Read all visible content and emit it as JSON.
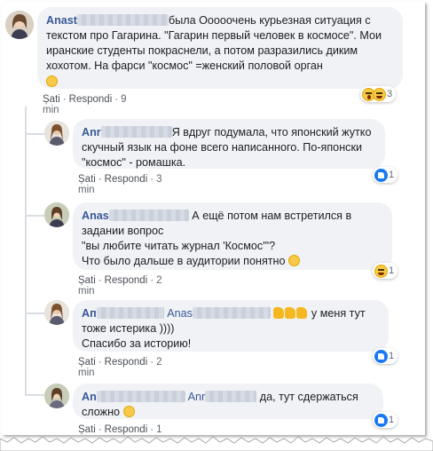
{
  "comments": [
    {
      "author": "Anast",
      "text": "была Ооооочень курьезная ситуация с текстом про Гагарина. \"Гагарин первый человек в космосе\". Мои иранские студенты покраснели, а потом разразились диким хохотом. На фарси \"космос\" =женский половой орган",
      "like": "Șati",
      "reply": "Respondi",
      "time": "9 min",
      "reaction_count": "3"
    },
    {
      "author": "Anr",
      "text": "Я вдруг подумала, что японский жутко скучный язык на фоне всего написанного. По-японски \"космос\" - ромашка.",
      "like": "Șati",
      "reply": "Respondi",
      "time": "3 min",
      "reaction_count": "1"
    },
    {
      "author": "Anas",
      "line1": "А ещё потом нам встретился в",
      "line2": "задании вопрос",
      "line3": "\"вы любите читать журнал 'Космос'\"?",
      "line4": "Что было дальше в аудитории понятно",
      "like": "Șati",
      "reply": "Respondi",
      "time": "2 min",
      "reaction_count": "1"
    },
    {
      "author": "Ап",
      "mention": "Anas",
      "tail": "у меня тут",
      "line2": "тоже истерика ))))",
      "line3": "Спасибо за историю!",
      "like": "Șati",
      "reply": "Respondi",
      "time": "2 min",
      "reaction_count": "1"
    },
    {
      "author": "An",
      "mention": "Anr",
      "tail": "да, тут сдержаться",
      "line2": "сложно",
      "like": "Șati",
      "reply": "Respondi",
      "time": "1 min",
      "reaction_count": "1"
    }
  ],
  "icons": [
    "avatar",
    "like-reaction-icon",
    "laugh-reaction-icon",
    "wow-reaction-icon",
    "emoji-icon",
    "thumbs-up-icon"
  ],
  "colors": {
    "author": "#385898",
    "bubble": "#f0f2f5",
    "like_blue": "#1877f2",
    "text": "#1c1e21",
    "meta": "#606770"
  }
}
